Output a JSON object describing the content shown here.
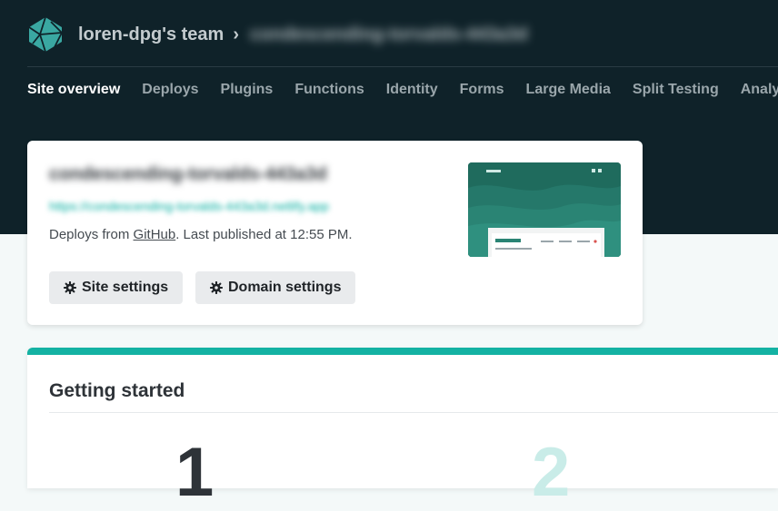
{
  "header": {
    "team_name": "loren-dpg's team",
    "breadcrumb_separator": "›",
    "site_name": "condescending-torvalds-443a3d"
  },
  "nav": {
    "items": [
      {
        "label": "Site overview",
        "active": true
      },
      {
        "label": "Deploys"
      },
      {
        "label": "Plugins"
      },
      {
        "label": "Functions"
      },
      {
        "label": "Identity"
      },
      {
        "label": "Forms"
      },
      {
        "label": "Large Media"
      },
      {
        "label": "Split Testing"
      },
      {
        "label": "Analyt"
      }
    ]
  },
  "site_card": {
    "title": "condescending-torvalds-443a3d",
    "url": "https://condescending-torvalds-443a3d.netlify.app",
    "deploy_prefix": "Deploys from ",
    "deploy_source": "GitHub",
    "deploy_suffix": ". Last published at 12:55 PM.",
    "site_settings_label": "Site settings",
    "domain_settings_label": "Domain settings"
  },
  "getting_started": {
    "title": "Getting started",
    "steps": [
      "1",
      "2"
    ]
  },
  "colors": {
    "header_bg": "#0f2229",
    "accent": "#14b2a3",
    "link": "#00ad9f"
  },
  "icons": {
    "logo": "netlify-logo-icon",
    "settings": "gear-icon"
  }
}
